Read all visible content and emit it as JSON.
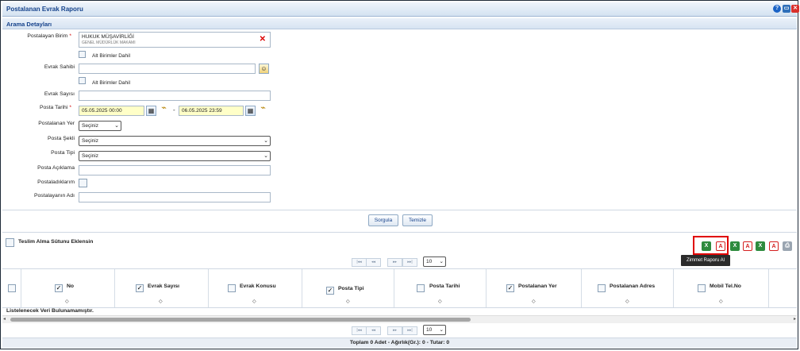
{
  "window": {
    "title": "Postalanan Evrak Raporu"
  },
  "section": {
    "title": "Arama Detayları"
  },
  "form": {
    "postalayan_birim": {
      "label": "Postalayan Birim",
      "required_mark": "*",
      "value_line1": "HUKUK MÜŞAVİRLİĞİ",
      "value_line2": "GENEL MÜDÜRLÜK MAKAMI"
    },
    "alt_birimler_1": {
      "label": "Alt Birimler Dahil"
    },
    "evrak_sahibi": {
      "label": "Evrak Sahibi"
    },
    "alt_birimler_2": {
      "label": "Alt Birimler Dahil"
    },
    "evrak_sayisi": {
      "label": "Evrak Sayısı"
    },
    "posta_tarihi": {
      "label": "Posta Tarihi",
      "required_mark": "*",
      "start": "05.05.2025 00:00",
      "end": "06.05.2025 23:59",
      "separator": "-"
    },
    "postalanan_yer": {
      "label": "Postalanan Yer",
      "selected": "Seçiniz"
    },
    "posta_sekli": {
      "label": "Posta Şekli",
      "selected": "Seçiniz"
    },
    "posta_tipi": {
      "label": "Posta Tipi",
      "selected": "Seçiniz"
    },
    "posta_aciklama": {
      "label": "Posta Açıklama"
    },
    "postaladiklarim": {
      "label": "Postaladıklarım"
    },
    "postalayanin_adi": {
      "label": "Postalayanın Adı"
    }
  },
  "actions": {
    "sorgula": "Sorgula",
    "temizle": "Temizle"
  },
  "grid_toolbar": {
    "teslim_alma": "Teslim Alma Sütunu Eklensin",
    "tooltip": "Zimmet Raporu Al"
  },
  "pager": {
    "page_size": "10",
    "first": "|◂◂",
    "prev": "◂◂",
    "next": "▸▸",
    "last": "▸▸|"
  },
  "columns": [
    {
      "name": "No",
      "checked": true
    },
    {
      "name": "Evrak Sayısı",
      "checked": true
    },
    {
      "name": "Evrak Konusu",
      "checked": false
    },
    {
      "name": "Posta Tipi",
      "checked": true
    },
    {
      "name": "Posta Tarihi",
      "checked": false
    },
    {
      "name": "Postalanan Yer",
      "checked": true
    },
    {
      "name": "Postalanan Adres",
      "checked": false
    },
    {
      "name": "Mobil Tel.No",
      "checked": false
    }
  ],
  "grid": {
    "empty_message": "Listelenecek Veri Bulunamamıştır."
  },
  "footer": {
    "summary": "Toplam 0 Adet - Ağırlık(Gr.): 0 - Tutar: 0"
  },
  "colors": {
    "accent": "#15428b",
    "highlight": "#e00000",
    "date_bg": "#ffffc8"
  }
}
